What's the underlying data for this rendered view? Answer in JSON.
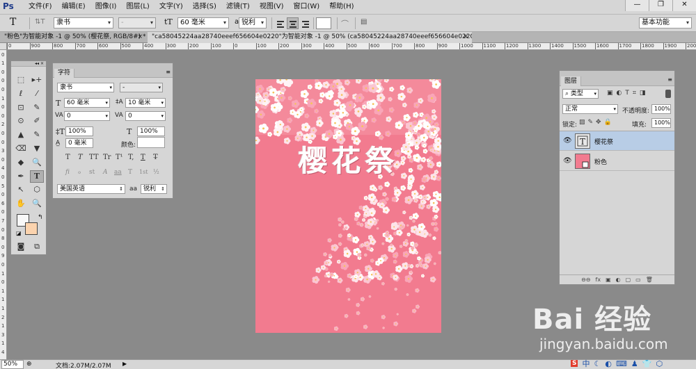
{
  "app": {
    "logo": "Ps"
  },
  "menu": [
    "文件(F)",
    "编辑(E)",
    "图像(I)",
    "图层(L)",
    "文字(Y)",
    "选择(S)",
    "滤镜(T)",
    "视图(V)",
    "窗口(W)",
    "帮助(H)"
  ],
  "window_controls": {
    "minimize": "—",
    "restore": "❐",
    "close": "✕"
  },
  "options_bar": {
    "tool_icon": "T",
    "orient_icon": "⇅T",
    "font_family": "隶书",
    "font_style": "-",
    "size_icon": "tT",
    "font_size": "60 毫米",
    "aa_icon": "aa",
    "antialias": "锐利",
    "workspace": "基本功能"
  },
  "tabs": [
    {
      "label": "\"粉色\"为智能对象 -1 @ 50% (樱花祭, RGB/8#) *",
      "close": "×",
      "active": false
    },
    {
      "label": "\"ca58045224aa28740eeef656604e0220\"为智能对象 -1 @ 50% (ca58045224aa28740eeef656604e0220, RGB/8#) *",
      "close": "×",
      "active": true
    }
  ],
  "rulers": {
    "h_ticks": [
      "0",
      "900",
      "800",
      "700",
      "600",
      "500",
      "400",
      "300",
      "200",
      "100",
      "0",
      "100",
      "200",
      "300",
      "400",
      "500",
      "600",
      "700",
      "800",
      "900",
      "1000",
      "1100",
      "1200",
      "1300",
      "1400",
      "1500",
      "1600",
      "1700",
      "1800",
      "1900",
      "2000",
      "2100"
    ],
    "v_ticks": [
      "2",
      "0",
      "1",
      "0",
      "0",
      "0",
      "1",
      "0",
      "0",
      "2",
      "0",
      "0",
      "3",
      "0",
      "4",
      "0",
      "5",
      "0",
      "6",
      "0",
      "7",
      "0",
      "8",
      "0",
      "9",
      "0",
      "1",
      "0",
      "1",
      "1",
      "1",
      "2",
      "1",
      "3",
      "1",
      "4"
    ]
  },
  "tools_panel": {
    "collapse": "◂◂  ×",
    "items": [
      "⬚",
      "▸+",
      "ℓ",
      "⁄",
      "⊡",
      "✎",
      "⊙",
      "✐",
      "▲",
      "✎",
      "⌫",
      "▼",
      "◆",
      "🔍",
      "✒",
      "T",
      "↖",
      "⬡",
      "✋",
      "🔍",
      "□",
      "⊞"
    ]
  },
  "character_panel": {
    "tab": "字符",
    "font_family": "隶书",
    "font_style": "-",
    "size": "60 毫米",
    "leading": "10 毫米",
    "kerning": "0",
    "tracking": "0",
    "vscale": "100%",
    "hscale": "100%",
    "baseline": "0 毫米",
    "color_label": "颜色:",
    "language": "美国英语",
    "aa_label": "aa",
    "antialias": "锐利",
    "style_buttons": [
      "T",
      "T",
      "TT",
      "Tr",
      "T¹",
      "T,",
      "T",
      "T̶"
    ],
    "opentype_buttons": [
      "fi",
      "ℴ",
      "st",
      "A",
      "aa",
      "T",
      "1st",
      "½"
    ]
  },
  "document": {
    "title": "樱花祭",
    "bg_color": "#f27b8f"
  },
  "layers_panel": {
    "tab": "图层",
    "filter": "类型",
    "blend_mode": "正常",
    "opacity_label": "不透明度:",
    "opacity": "100%",
    "lock_label": "锁定:",
    "fill_label": "填充:",
    "fill": "100%",
    "layers": [
      {
        "name": "樱花祭",
        "selected": true
      },
      {
        "name": "粉色",
        "selected": false
      }
    ],
    "bottom_icons": [
      "⊖⊖",
      "fx",
      "▣",
      "◐",
      "▢",
      "▭",
      "🗑"
    ]
  },
  "status_bar": {
    "zoom": "50%",
    "doc_info": "文档:2.07M/2.07M"
  },
  "watermark": {
    "brand": "Bai 经验",
    "url": "jingyan.baidu.com"
  },
  "tray": [
    "S",
    "中",
    "☾",
    "◐",
    "⌨",
    "♟",
    "👕",
    "⬡"
  ]
}
